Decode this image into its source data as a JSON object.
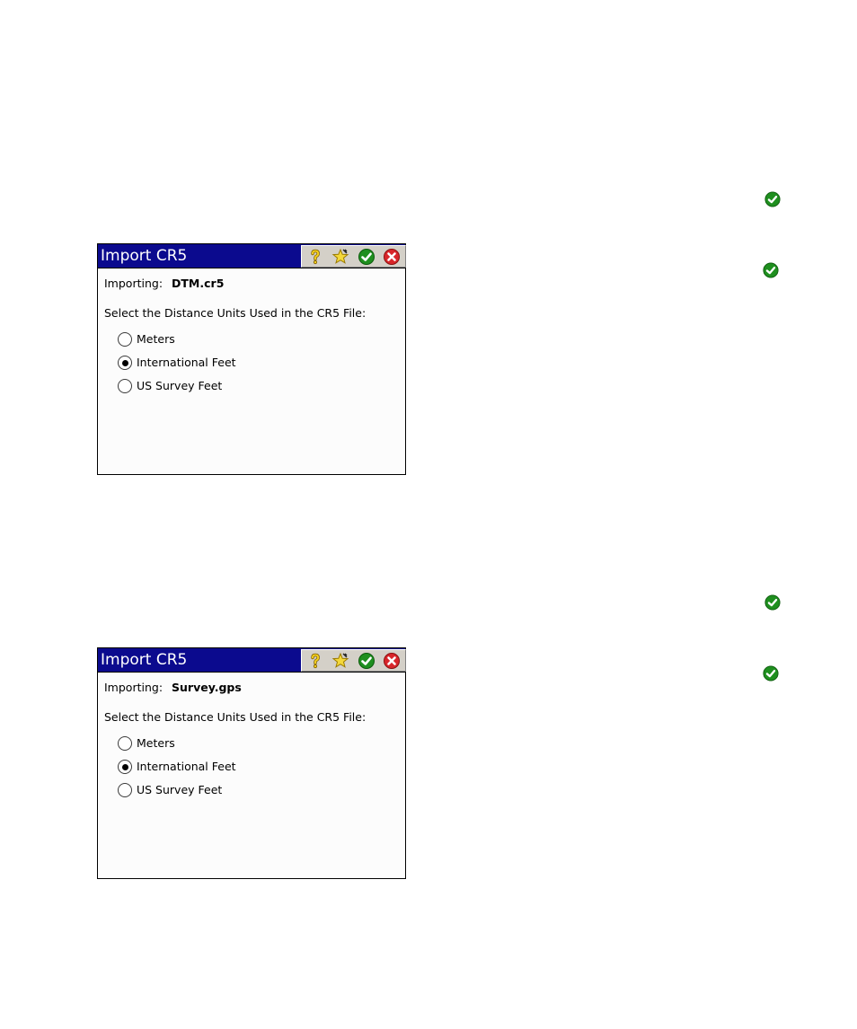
{
  "colors": {
    "titlebar": "#0b0a8e",
    "check_green": "#1f8f1f",
    "close_red": "#d8262a",
    "help_yellow": "#e6c21a"
  },
  "side_icons": [
    "check-icon",
    "check-icon",
    "check-icon",
    "check-icon"
  ],
  "dialogs": [
    {
      "title": "Import CR5",
      "importing_label": "Importing:",
      "file_name": "DTM.cr5",
      "instruction": "Select the Distance Units Used in the CR5 File:",
      "options": [
        {
          "label": "Meters",
          "selected": false
        },
        {
          "label": "International Feet",
          "selected": true
        },
        {
          "label": "US Survey Feet",
          "selected": false
        }
      ],
      "toolbar_icons": [
        "help-icon",
        "favorite-star-icon",
        "ok-check-icon",
        "close-icon"
      ]
    },
    {
      "title": "Import CR5",
      "importing_label": "Importing:",
      "file_name": "Survey.gps",
      "instruction": "Select the Distance Units Used in the CR5 File:",
      "options": [
        {
          "label": "Meters",
          "selected": false
        },
        {
          "label": "International Feet",
          "selected": true
        },
        {
          "label": "US Survey Feet",
          "selected": false
        }
      ],
      "toolbar_icons": [
        "help-icon",
        "favorite-star-icon",
        "ok-check-icon",
        "close-icon"
      ]
    }
  ]
}
